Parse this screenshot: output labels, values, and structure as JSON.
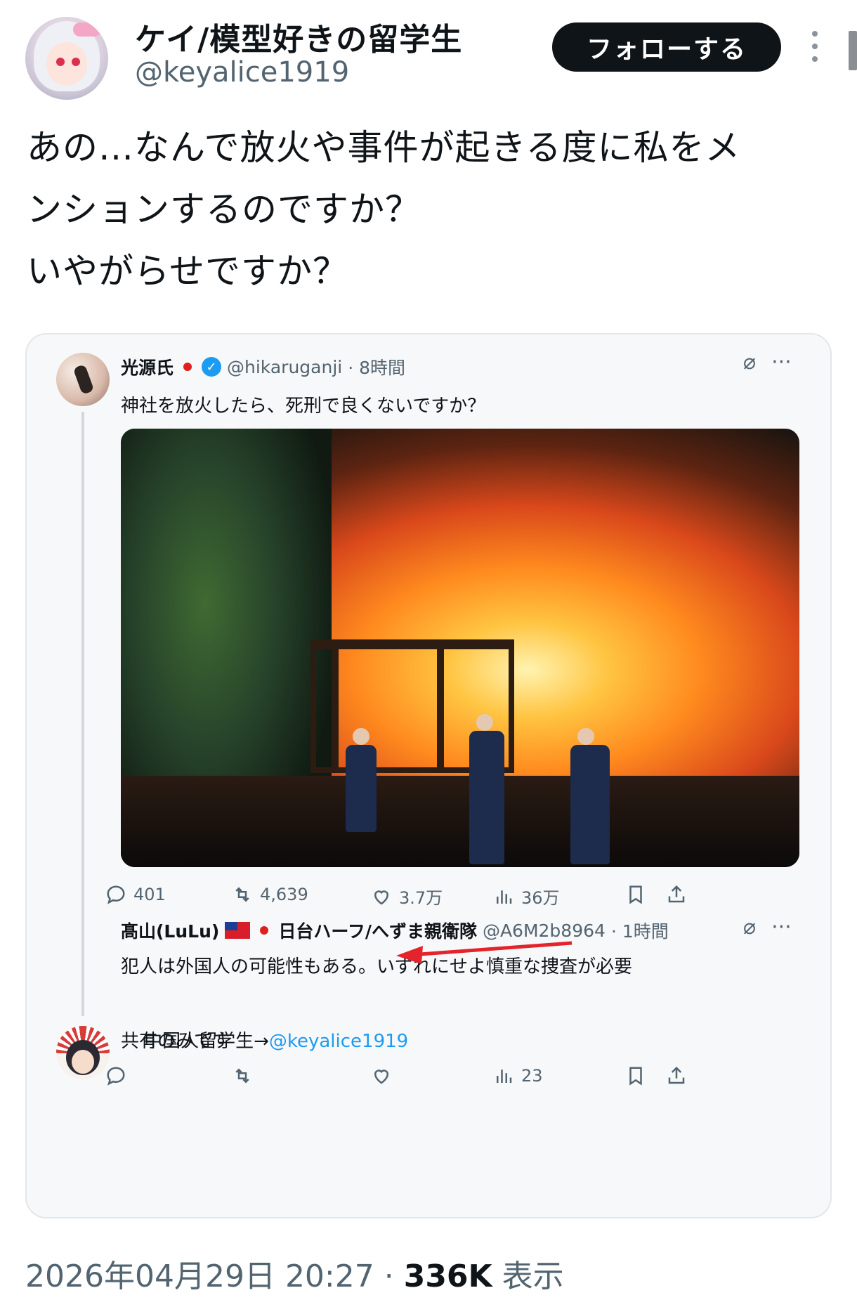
{
  "author": {
    "display_name": "ケイ/模型好きの留学生",
    "handle": "@keyalice1919",
    "follow_label": "フォローする"
  },
  "tweet": {
    "text": "あの…なんで放火や事件が起きる度に私をメ\nンションするのですか？\nいやがらせですか？"
  },
  "quote1": {
    "name": "光源氏",
    "handle": "@hikaruganji",
    "time": "· 8時間",
    "text": "神社を放火したら、死刑で良くないですか？",
    "replies": "401",
    "retweets": "4,639",
    "likes": "3.7万",
    "views": "36万"
  },
  "quote2": {
    "name_part1": "髙山(LuLu)",
    "name_part2": "日台ハーフ/へずま親衛隊",
    "handle": "@A6M2b8964",
    "time": "· 1時間",
    "text_line1": "犯人は外国人の可能性もある。いずれにせよ慎重な捜査が必要",
    "text_line2_prefix": "中国人留学生→",
    "text_line2_mention": "@keyalice1919",
    "text_line3": "共有のみです",
    "views": "23"
  },
  "footer": {
    "timestamp": "2026年04月29日 20:27 · ",
    "views_count": "336K",
    "views_label": " 表示"
  },
  "colors": {
    "accent": "#1d9bf0",
    "text": "#0f1419",
    "muted": "#536471",
    "arrow": "#e3242b"
  }
}
